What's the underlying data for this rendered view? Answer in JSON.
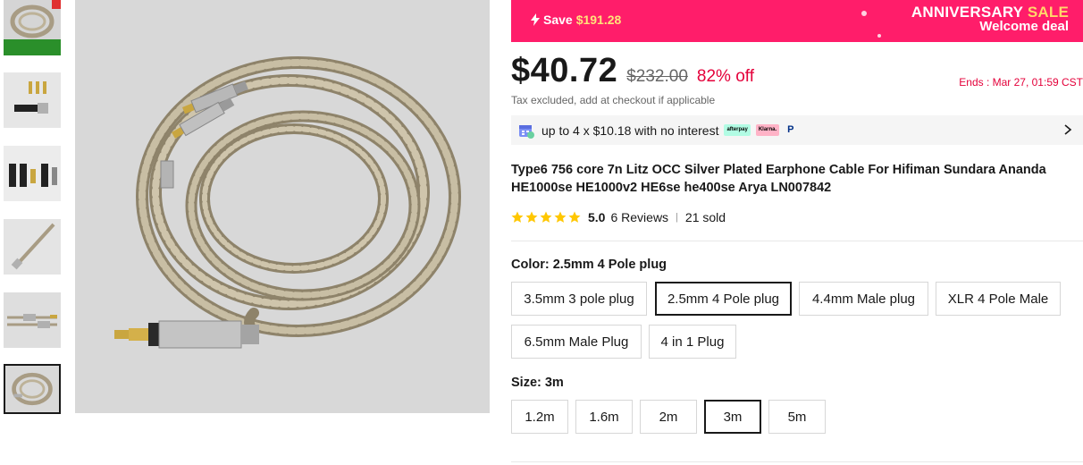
{
  "gallery": {
    "thumbnails": [
      {
        "label": "Cable thumbnail with banner"
      },
      {
        "label": "Connector plugs"
      },
      {
        "label": "Plug options"
      },
      {
        "label": "Cable close-up"
      },
      {
        "label": "Cable plugs side"
      },
      {
        "label": "Coiled cable",
        "active": true
      }
    ]
  },
  "banner": {
    "save_label": "Save",
    "save_amount": "$191.28",
    "anniversary": "ANNIVERSARY",
    "sale": "SALE",
    "welcome": "Welcome deal",
    "bg_color": "#ff1d6a"
  },
  "pricing": {
    "price": "$40.72",
    "original": "$232.00",
    "discount": "82% off",
    "ends": "Ends :  Mar 27, 01:59 CST",
    "tax_note": "Tax excluded, add at checkout if applicable"
  },
  "installment": {
    "text": "up to 4 x $10.18 with no interest",
    "badges": [
      "afterpay",
      "Klarna.",
      "P"
    ]
  },
  "product": {
    "title": "Type6 756 core 7n Litz OCC Silver Plated Earphone Cable For Hifiman Sundara Ananda HE1000se HE1000v2 HE6se he400se Arya LN007842",
    "rating": "5.0",
    "reviews": "6 Reviews",
    "sold": "21 sold",
    "stars": 5
  },
  "color": {
    "label": "Color: 2.5mm 4 Pole plug",
    "options": [
      "3.5mm 3 pole plug",
      "2.5mm 4 Pole plug",
      "4.4mm Male plug",
      "XLR 4 Pole Male",
      "6.5mm Male Plug",
      "4 in 1 Plug"
    ],
    "selected": "2.5mm 4 Pole plug"
  },
  "size": {
    "label": "Size: 3m",
    "options": [
      "1.2m",
      "1.6m",
      "2m",
      "3m",
      "5m"
    ],
    "selected": "3m"
  }
}
